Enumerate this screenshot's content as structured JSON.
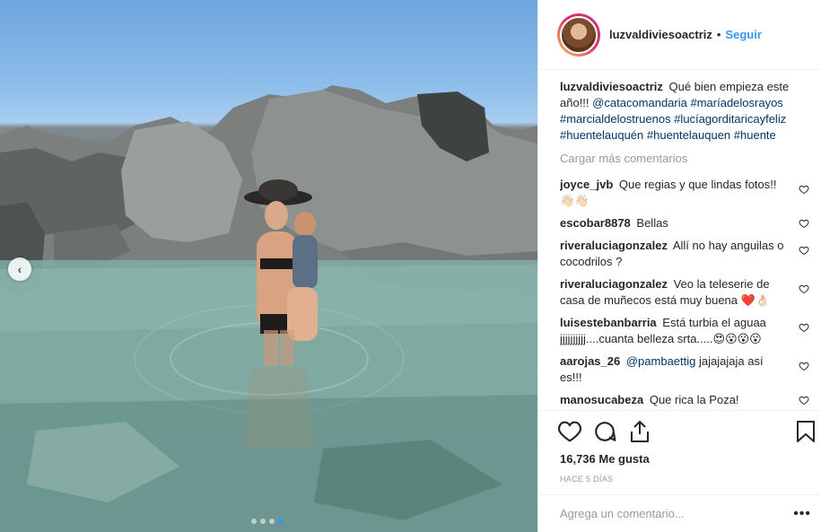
{
  "post": {
    "user": "luzvaldiviesoactriz",
    "follow_label": "Seguir",
    "separator": "•"
  },
  "caption": {
    "user": "luzvaldiviesoactriz",
    "text": "Qué bien empieza este año!!!",
    "tags": [
      "@catacomandaria",
      "#maríadelosrayos",
      "#marcialdelostruenos",
      "#lucíagorditaricayfeliz",
      "#huentelauquén",
      "#huentelauquen",
      "#huente"
    ]
  },
  "load_more": "Cargar más comentarios",
  "comments": [
    {
      "user": "joyce_jvb",
      "text": "Que regias y que lindas fotos!!👋🏻👋🏻"
    },
    {
      "user": "escobar8878",
      "text": "Bellas"
    },
    {
      "user": "riveraluciagonzalez",
      "text": "Allí no hay anguilas o cocodrilos ?"
    },
    {
      "user": "riveraluciagonzalez",
      "text": "Veo la teleserie de casa de muñecos está muy buena ❤️👌🏻"
    },
    {
      "user": "luisestebanbarria",
      "text": "Está turbia el aguaa jjjjjjjjjj....cuanta belleza srta.....😍😮😮😮"
    },
    {
      "user": "aarojas_26",
      "mention": "@pambaettig",
      "text": "jajajajaja así es!!!"
    },
    {
      "user": "manosucabeza",
      "text": "Que rica la Poza!"
    }
  ],
  "actions": {
    "like_icon": "heart-icon",
    "comment_icon": "comment-icon",
    "share_icon": "share-icon",
    "save_icon": "bookmark-icon"
  },
  "likes": "16,736 Me gusta",
  "time": "HACE 5 DÍAS",
  "add_comment": {
    "placeholder": "Agrega un comentario...",
    "options_label": "•••"
  },
  "carousel": {
    "prev_icon": "chevron-left-icon",
    "prev_label": "‹",
    "dots": 4,
    "active_dot": 3
  },
  "colors": {
    "link": "#3897f0",
    "tag": "#003569",
    "muted": "#999999"
  }
}
